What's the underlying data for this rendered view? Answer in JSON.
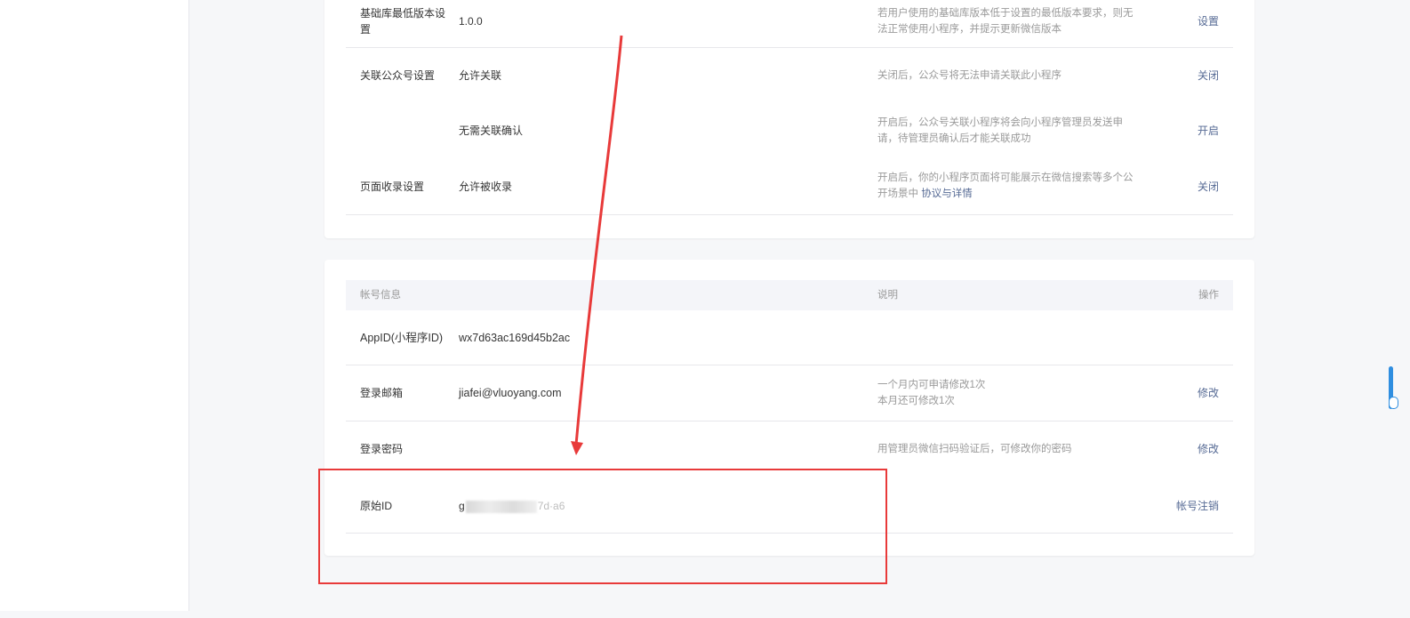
{
  "settings": {
    "rows": [
      {
        "label_line1": "基础库最低版本设",
        "label_line2": "置",
        "value": "1.0.0",
        "desc_line1": "若用户使用的基础库版本低于设置的最低版本要求，则无",
        "desc_line2": "法正常使用小程序，并提示更新微信版本",
        "action": "设置"
      },
      {
        "label": "关联公众号设置",
        "value": "允许关联",
        "desc": "关闭后，公众号将无法申请关联此小程序",
        "action": "关闭"
      },
      {
        "value": "无需关联确认",
        "desc_line1": "开启后，公众号关联小程序将会向小程序管理员发送申",
        "desc_line2": "请，待管理员确认后才能关联成功",
        "action": "开启"
      },
      {
        "label": "页面收录设置",
        "value": "允许被收录",
        "desc_line1": "开启后，你的小程序页面将可能展示在微信搜索等多个公",
        "desc_line2_prefix": "开场景中",
        "desc_link": "协议与详情",
        "action": "关闭"
      }
    ]
  },
  "account": {
    "header": {
      "col_info": "帐号信息",
      "col_desc": "说明",
      "col_action": "操作"
    },
    "rows": [
      {
        "label": "AppID(小程序ID)",
        "value": "wx7d63ac169d45b2ac"
      },
      {
        "label": "登录邮箱",
        "value": "jiafei@vluoyang.com",
        "desc_line1": "一个月内可申请修改1次",
        "desc_line2": "本月还可修改1次",
        "action": "修改"
      },
      {
        "label": "登录密码",
        "desc": "用管理员微信扫码验证后，可修改你的密码",
        "action": "修改"
      },
      {
        "label": "原始ID",
        "value_prefix": "g",
        "value_suffix": "7d·a6",
        "action": "帐号注销"
      }
    ]
  },
  "colors": {
    "accent": "#576b95",
    "annotation": "#e83a3a",
    "scrollbar": "#2f8ee0"
  }
}
